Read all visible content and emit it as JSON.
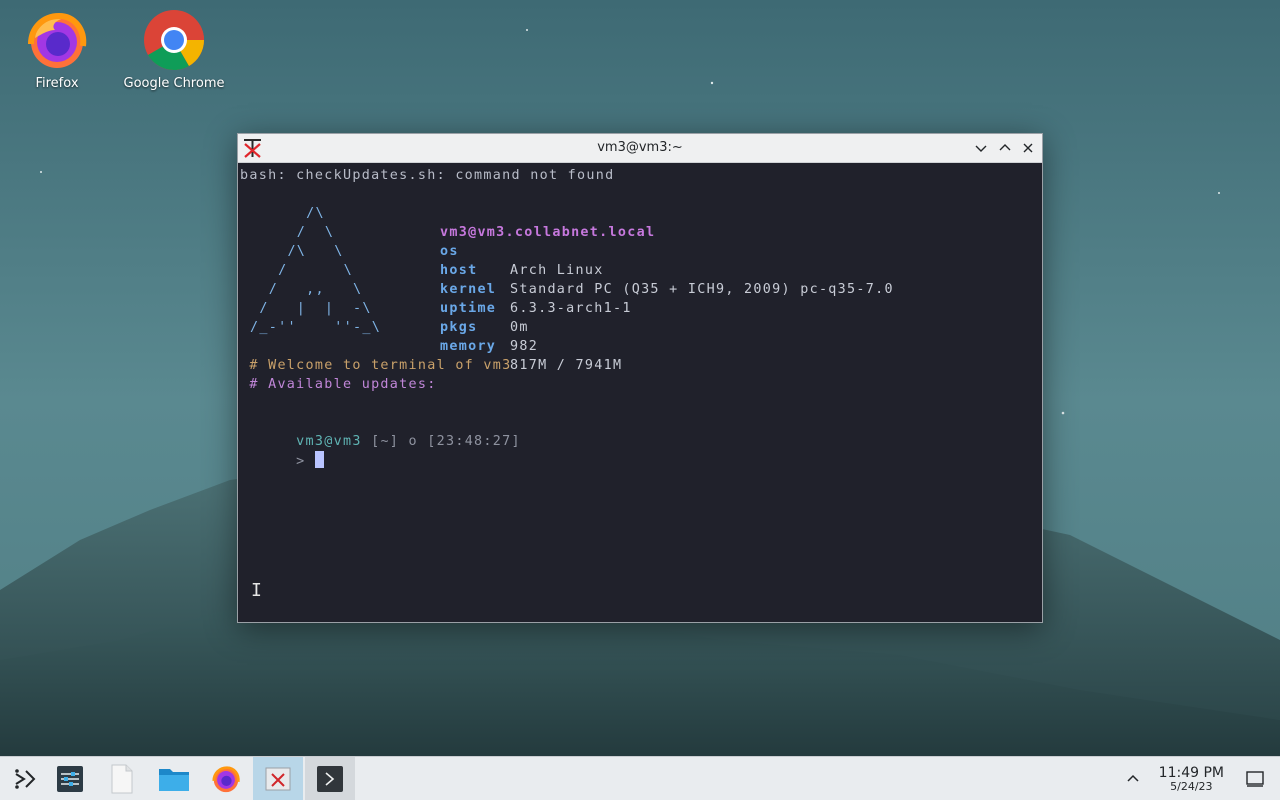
{
  "desktop": {
    "icons": [
      {
        "label": "Firefox",
        "icon": "firefox-icon"
      },
      {
        "label": "Google Chrome",
        "icon": "chrome-icon"
      }
    ]
  },
  "terminal": {
    "title": "vm3@vm3:~",
    "error_line": "bash: checkUpdates.sh: command not found",
    "logo_lines": [
      "      /\\",
      "     /  \\",
      "    /\\   \\",
      "   /      \\",
      "  /   ,,   \\",
      " /   |  |  -\\",
      "/_-''    ''-_\\"
    ],
    "hostname": "vm3@vm3.collabnet.local",
    "info": [
      {
        "key": "os",
        "value": "Arch Linux"
      },
      {
        "key": "host",
        "value": "Standard PC (Q35 + ICH9, 2009) pc-q35-7.0"
      },
      {
        "key": "kernel",
        "value": "6.3.3-arch1-1"
      },
      {
        "key": "uptime",
        "value": "0m"
      },
      {
        "key": "pkgs",
        "value": "982"
      },
      {
        "key": "memory",
        "value": "817M / 7941M"
      }
    ],
    "welcome": " # Welcome to terminal of vm3",
    "updates": " # Available updates:",
    "prompt_user": "vm3@vm3",
    "prompt_rest": " [~] o [23:48:27]",
    "prompt_symbol": ">"
  },
  "taskbar": {
    "items": [
      "launcher-icon",
      "settings-icon",
      "blank-file-icon",
      "folder-icon",
      "firefox-icon",
      "x-terminal-icon",
      "konsole-icon"
    ],
    "time": "11:49 PM",
    "date": "5/24/23"
  },
  "colors": {
    "terminal_bg": "#20212b",
    "hostname": "#c678dd",
    "info_key": "#6aa8e8",
    "comment": "#c9a16a",
    "cursor": "#b9c4ff",
    "taskbar_active": "#b8d6e8"
  }
}
